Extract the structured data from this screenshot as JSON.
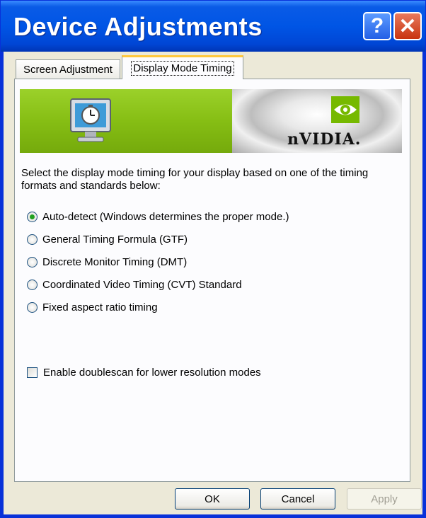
{
  "window": {
    "title": "Device Adjustments"
  },
  "titlebar_buttons": {
    "help": "?",
    "close": "✕"
  },
  "tabs": [
    {
      "label": "Screen Adjustment",
      "active": false
    },
    {
      "label": "Display Mode Timing",
      "active": true
    }
  ],
  "banner": {
    "brand": "nVIDIA.",
    "icons": [
      "monitor-timer-icon",
      "nvidia-eye-logo"
    ]
  },
  "description": "Select the display mode timing for your display based on one of the timing formats and standards below:",
  "timing_options": [
    {
      "label": "Auto-detect (Windows determines the proper mode.)",
      "checked": true
    },
    {
      "label": "General Timing Formula (GTF)",
      "checked": false
    },
    {
      "label": "Discrete Monitor Timing (DMT)",
      "checked": false
    },
    {
      "label": "Coordinated Video Timing (CVT) Standard",
      "checked": false
    },
    {
      "label": "Fixed aspect ratio timing",
      "checked": false
    }
  ],
  "doublescan": {
    "label": "Enable doublescan for lower resolution modes",
    "checked": false
  },
  "buttons": {
    "ok": "OK",
    "cancel": "Cancel",
    "apply": "Apply"
  },
  "colors": {
    "titlebar": "#0055E5",
    "banner_green": "#86BE14",
    "selected_radio": "#21A121"
  }
}
